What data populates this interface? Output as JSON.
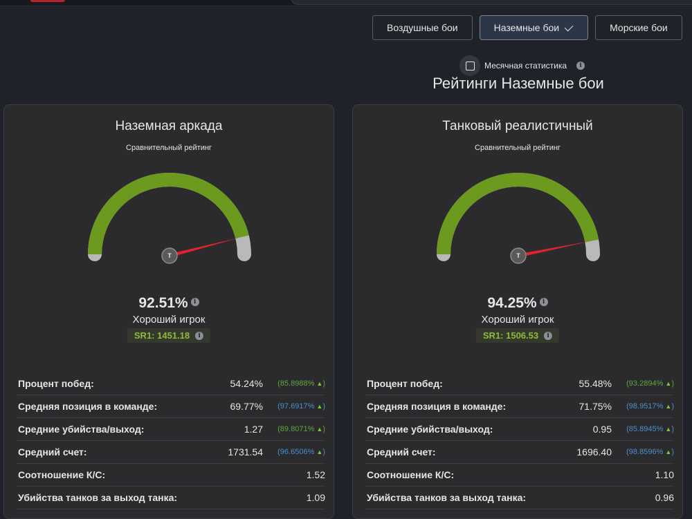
{
  "mode_buttons": [
    {
      "label": "Воздушные бои",
      "active": false
    },
    {
      "label": "Наземные бои",
      "active": true
    },
    {
      "label": "Морские бои",
      "active": false
    }
  ],
  "monthly": {
    "label": "Месячная статистика",
    "checked": false
  },
  "ratings_title": "Рейтинги Наземные бои",
  "colors": {
    "gauge_fill": "#6c9a1f",
    "gauge_track": "#b9b9b9",
    "needle": "#e0242f",
    "good": "#8fbb3a"
  },
  "cards": [
    {
      "title": "Наземная аркада",
      "compare_label": "Сравнительный рейтинг",
      "gauge_value": 0.9251,
      "needle_letter": "T",
      "percent": "92.51%",
      "level": "Хороший игрок",
      "sr": "SR1: 1451.18",
      "stats": [
        {
          "label": "Процент побед:",
          "value": "54.24%",
          "pct": "(85.8988%",
          "color": "green"
        },
        {
          "label": "Средняя позиция в команде:",
          "value": "69.77%",
          "pct": "(97.6917%",
          "color": "blue"
        },
        {
          "label": "Средние убийства/выход:",
          "value": "1.27",
          "pct": "(89.8071%",
          "color": "green"
        },
        {
          "label": "Средний счет:",
          "value": "1731.54",
          "pct": "(96.6506%",
          "color": "blue"
        },
        {
          "label": "Соотношение К/С:",
          "value": "1.52",
          "pct": "",
          "color": ""
        },
        {
          "label": "Убийства танков за выход танка:",
          "value": "1.09",
          "pct": "",
          "color": ""
        }
      ]
    },
    {
      "title": "Танковый реалистичный",
      "compare_label": "Сравнительный рейтинг",
      "gauge_value": 0.9425,
      "needle_letter": "T",
      "percent": "94.25%",
      "level": "Хороший игрок",
      "sr": "SR1: 1506.53",
      "stats": [
        {
          "label": "Процент побед:",
          "value": "55.48%",
          "pct": "(93.2894%",
          "color": "green"
        },
        {
          "label": "Средняя позиция в команде:",
          "value": "71.75%",
          "pct": "(98.9517%",
          "color": "blue"
        },
        {
          "label": "Средние убийства/выход:",
          "value": "0.95",
          "pct": "(85.8945%",
          "color": "blue"
        },
        {
          "label": "Средний счет:",
          "value": "1696.40",
          "pct": "(98.8596%",
          "color": "blue"
        },
        {
          "label": "Соотношение К/С:",
          "value": "1.10",
          "pct": "",
          "color": ""
        },
        {
          "label": "Убийства танков за выход танка:",
          "value": "0.96",
          "pct": "",
          "color": ""
        }
      ]
    }
  ]
}
